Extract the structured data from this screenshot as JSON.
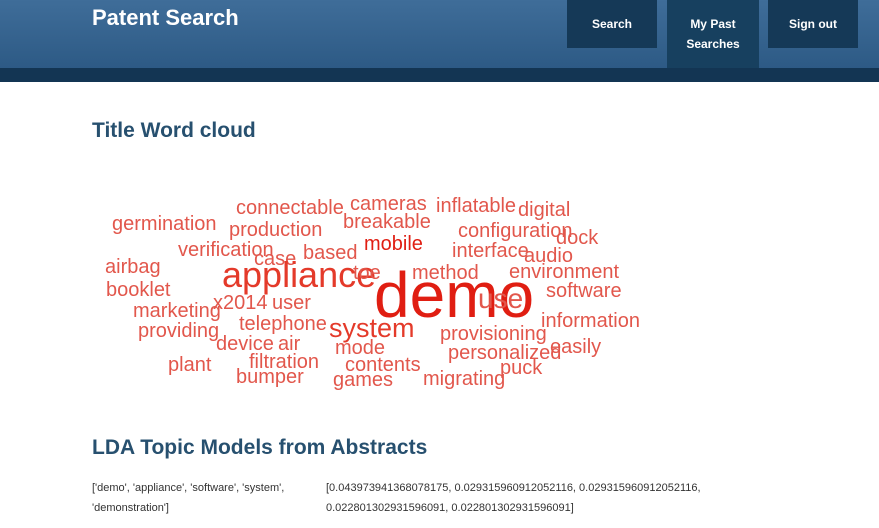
{
  "header": {
    "title": "Patent Search",
    "nav": {
      "search": "Search",
      "past_searches_line1": "My Past",
      "past_searches_line2": "Searches",
      "sign_out": "Sign out"
    }
  },
  "wordcloud": {
    "title": "Title Word cloud",
    "words": [
      "demo",
      "appliance",
      "system",
      "use",
      "toe",
      "method",
      "connectable",
      "cameras",
      "inflatable",
      "digital",
      "germination",
      "breakable",
      "production",
      "configuration",
      "dock",
      "verification",
      "based",
      "mobile",
      "interface",
      "audio",
      "airbag",
      "case",
      "environment",
      "booklet",
      "software",
      "marketing",
      "x2014",
      "user",
      "information",
      "providing",
      "telephone",
      "provisioning",
      "device",
      "air",
      "mode",
      "easily",
      "personalized",
      "plant",
      "filtration",
      "contents",
      "puck",
      "bumper",
      "games",
      "migrating"
    ]
  },
  "lda": {
    "title": "LDA Topic Models from Abstracts",
    "words_line1": "['demo', 'appliance', 'software', 'system',",
    "words_line2": "'demonstration']",
    "values_line1": "[0.043973941368078175, 0.029315960912052116, 0.029315960912052116,",
    "values_line2": "0.022801302931596091, 0.022801302931596091]"
  }
}
